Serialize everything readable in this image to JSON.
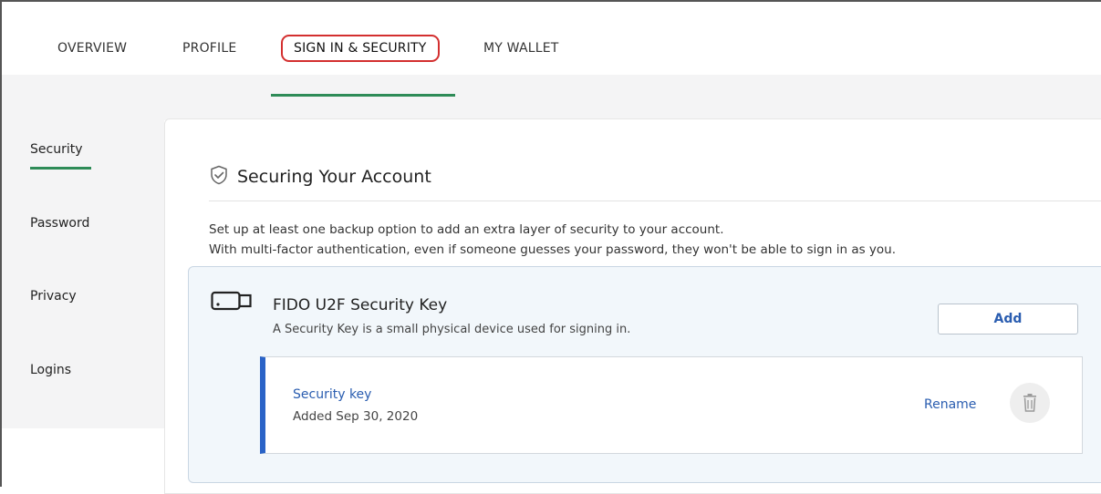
{
  "tabs": [
    {
      "label": "OVERVIEW"
    },
    {
      "label": "PROFILE"
    },
    {
      "label": "SIGN IN & SECURITY",
      "active": true
    },
    {
      "label": "MY WALLET"
    }
  ],
  "sidebar": {
    "items": [
      {
        "label": "Security",
        "active": true
      },
      {
        "label": "Password"
      },
      {
        "label": "Privacy"
      },
      {
        "label": "Logins"
      }
    ]
  },
  "main": {
    "heading": "Securing Your Account",
    "description_line1": "Set up at least one backup option to add an extra layer of security to your account.",
    "description_line2": "With multi-factor authentication, even if someone guesses your password, they won't be able to sign in as you."
  },
  "fido": {
    "title": "FIDO U2F Security Key",
    "subtitle": "A Security Key is a small physical device used for signing in.",
    "add_label": "Add",
    "keys": [
      {
        "name": "Security key",
        "added": "Added Sep 30, 2020",
        "rename_label": "Rename"
      }
    ]
  },
  "colors": {
    "accent_green": "#2e8b57",
    "link_blue": "#2a5db0",
    "highlight_red": "#d32f2f",
    "key_bar_blue": "#2a63c7"
  },
  "icons": {
    "heading": "shield-check-icon",
    "card": "usb-key-icon",
    "delete": "trash-icon"
  }
}
